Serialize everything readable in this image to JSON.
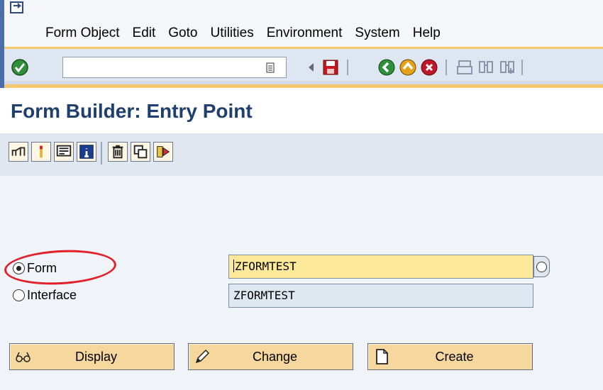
{
  "menu": {
    "items": [
      "Form Object",
      "Edit",
      "Goto",
      "Utilities",
      "Environment",
      "System",
      "Help"
    ]
  },
  "toolbar": {
    "command_field_value": ""
  },
  "page_title": "Form Builder: Entry Point",
  "form": {
    "form_label": "Form",
    "form_value": "ZFORMTEST",
    "interface_label": "Interface",
    "interface_value": "ZFORMTEST",
    "selected": "Form"
  },
  "buttons": {
    "display": "Display",
    "change": "Change",
    "create": "Create"
  },
  "colors": {
    "title": "#1f3f6e",
    "required_field": "#fbe899",
    "button": "#f6d79d",
    "highlight_circle": "#e0202a"
  }
}
